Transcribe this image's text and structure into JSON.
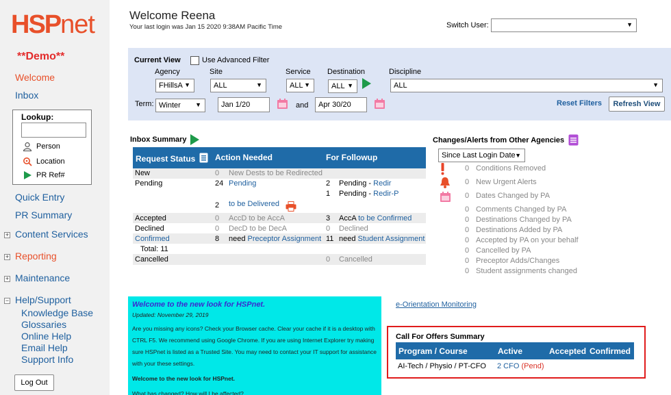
{
  "app": {
    "logo_main": "HSP",
    "logo_suffix": "net",
    "demo_label": "**Demo**"
  },
  "sidebar": {
    "welcome": "Welcome",
    "inbox": "Inbox",
    "lookup": {
      "title": "Lookup:",
      "input_value": "",
      "items": [
        "Person",
        "Location",
        "PR Ref#"
      ]
    },
    "quick_entry": "Quick Entry",
    "pr_summary": "PR Summary",
    "content_services": "Content Services",
    "reporting": "Reporting",
    "maintenance": "Maintenance",
    "help_support": "Help/Support",
    "help_items": [
      "Knowledge Base",
      "Glossaries",
      "Online Help",
      "Email Help",
      "Support Info"
    ],
    "logout": "Log Out"
  },
  "header": {
    "welcome": "Welcome Reena",
    "last_login": "Your last login was Jan 15 2020 9:38AM Pacific Time",
    "switch_user_label": "Switch User:",
    "switch_user_value": ""
  },
  "filter": {
    "current_view": "Current View",
    "advanced_filter": "Use Advanced Filter",
    "agency_label": "Agency",
    "agency_value": "FHillsA",
    "site_label": "Site",
    "site_value": "ALL",
    "service_label": "Service",
    "service_value": "ALL",
    "destination_label": "Destination",
    "destination_value": "ALL",
    "discipline_label": "Discipline",
    "discipline_value": "ALL",
    "term_label": "Term:",
    "term_value": "Winter",
    "start_date": "Jan 1/20",
    "and_label": "and",
    "end_date": "Apr 30/20",
    "reset": "Reset Filters",
    "refresh": "Refresh View"
  },
  "inbox": {
    "title": "Inbox Summary",
    "headers": {
      "status": "Request Status",
      "action": "Action Needed",
      "followup": "For Followup"
    },
    "rows": {
      "new": {
        "label": "New",
        "a_count": "0",
        "a_text": "New Dests to be Redirected"
      },
      "pending": {
        "label": "Pending",
        "a_count": "24",
        "a_text": "Pending",
        "a2_count": "2",
        "a2_text": "to be Delivered",
        "f1_count": "2",
        "f1_prefix": "Pending - ",
        "f1_link": "Redir",
        "f2_count": "1",
        "f2_prefix": "Pending - ",
        "f2_link": "Redir-P"
      },
      "accepted": {
        "label": "Accepted",
        "a_count": "0",
        "a_text": "AccD to be AccA",
        "f_count": "3",
        "f_prefix": "AccA ",
        "f_link": "to be Confirmed"
      },
      "declined": {
        "label": "Declined",
        "a_count": "0",
        "a_text": "DecD to be DecA",
        "f_count": "0",
        "f_text": "Declined"
      },
      "confirmed": {
        "label": "Confirmed",
        "a_count": "8",
        "a_prefix": "need ",
        "a_link": "Preceptor Assignment",
        "f_count": "11",
        "f_prefix": "need ",
        "f_link": "Student Assignment"
      },
      "total": {
        "label": "Total:",
        "value": "11"
      },
      "cancelled": {
        "label": "Cancelled",
        "f_count": "0",
        "f_text": "Cancelled"
      }
    }
  },
  "alerts": {
    "title": "Changes/Alerts from Other Agencies",
    "period": "Since Last Login Date",
    "items": [
      {
        "count": "0",
        "label": "Conditions Removed"
      },
      {
        "count": "0",
        "label": "New Urgent Alerts"
      },
      {
        "count": "0",
        "label": "Dates Changed by PA"
      },
      {
        "count": "0",
        "label": "Comments Changed by PA"
      },
      {
        "count": "0",
        "label": "Destinations Changed by PA"
      },
      {
        "count": "0",
        "label": "Destinations Added by PA"
      },
      {
        "count": "0",
        "label": "Accepted by PA on your behalf"
      },
      {
        "count": "0",
        "label": "Cancelled by PA"
      },
      {
        "count": "0",
        "label": "Preceptor Adds/Changes"
      },
      {
        "count": "0",
        "label": "Student assignments changed"
      }
    ]
  },
  "news": {
    "title": "Welcome to the new look for HSPnet.",
    "updated": "Updated: November 29, 2019",
    "body": "Are you missing any icons? Check your Browser cache. Clear your cache if it is a desktop with CTRL F5. We recommend using Google Chrome. If you are using Internet Explorer try making sure HSPnet is listed as a Trusted Site. You may need to contact your IT support for assistance with your these settings.",
    "heading2": "Welcome to the new look for HSPnet.",
    "more": "What has changed? How will I be affected?"
  },
  "eorientation": "e-Orientation Monitoring",
  "cfo": {
    "title": "Call For Offers Summary",
    "headers": {
      "program": "Program / Course",
      "active": "Active",
      "accepted": "Accepted",
      "confirmed": "Confirmed"
    },
    "row": {
      "program": "AI-Tech / Physio / PT-CFO",
      "active": "2 CFO",
      "pend": "(Pend)"
    }
  },
  "colors": {
    "brand": "#e8502a",
    "link": "#1e5f9e",
    "header_bar": "#1f6ba8",
    "filter_bg": "#dde5f5",
    "news_bg": "#00e8e8",
    "highlight_border": "#e01b1b"
  }
}
